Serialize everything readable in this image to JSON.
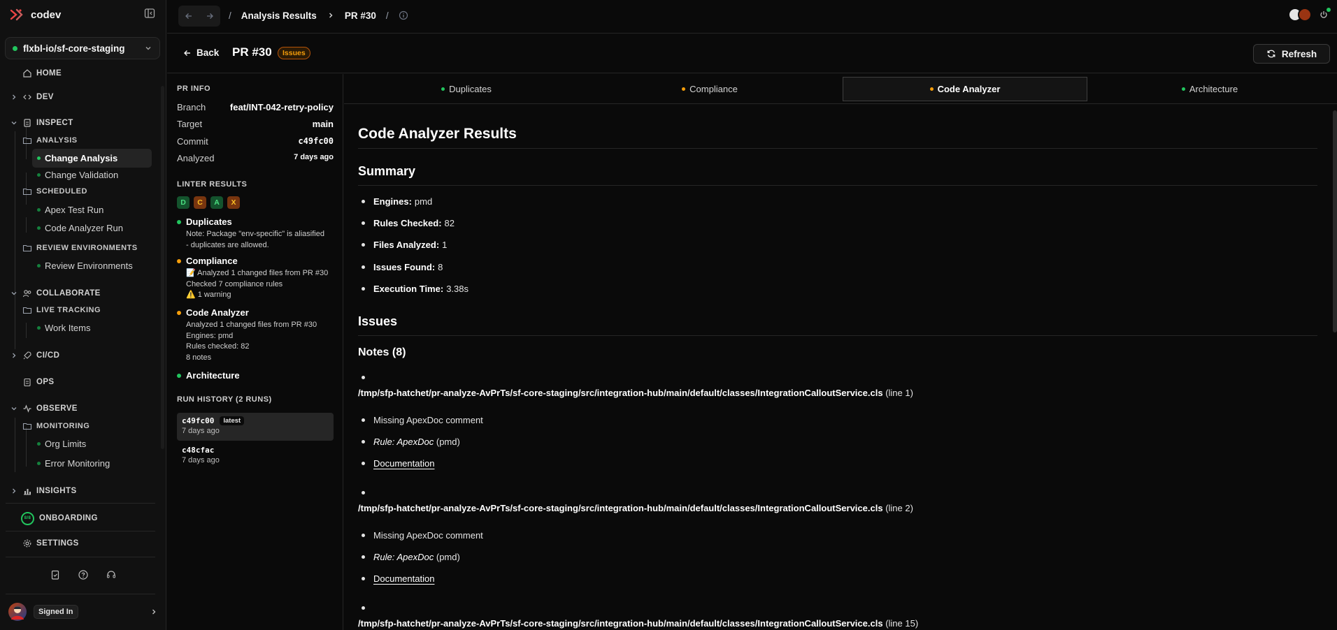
{
  "app": {
    "name": "codev"
  },
  "repo": {
    "name": "flxbl-io/sf-core-staging"
  },
  "nav": {
    "home": "HOME",
    "dev": "DEV",
    "inspect": "INSPECT",
    "analysis": "ANALYSIS",
    "change_analysis": "Change Analysis",
    "change_validation": "Change Validation",
    "scheduled": "SCHEDULED",
    "apex_test_run": "Apex Test Run",
    "code_analyzer_run": "Code Analyzer Run",
    "review_envs_group": "REVIEW ENVIRONMENTS",
    "review_envs": "Review Environments",
    "collaborate": "COLLABORATE",
    "live_tracking": "LIVE TRACKING",
    "work_items": "Work Items",
    "cicd": "CI/CD",
    "ops": "OPS",
    "observe": "OBSERVE",
    "monitoring": "MONITORING",
    "org_limits": "Org Limits",
    "error_monitoring": "Error Monitoring",
    "insights": "INSIGHTS",
    "onboarding": "ONBOARDING",
    "onboarding_progress": "8/8",
    "settings": "SETTINGS"
  },
  "user": {
    "status": "Signed In"
  },
  "breadcrumb": {
    "first": "Analysis Results",
    "second": "PR #30"
  },
  "header": {
    "back": "Back",
    "title": "PR #30",
    "badge": "Issues",
    "refresh": "Refresh"
  },
  "pr_info": {
    "heading": "PR INFO",
    "branch_label": "Branch",
    "branch": "feat/INT-042-retry-policy",
    "target_label": "Target",
    "target": "main",
    "commit_label": "Commit",
    "commit": "c49fc00",
    "analyzed_label": "Analyzed",
    "analyzed": "7 days ago"
  },
  "linter": {
    "heading": "LINTER RESULTS",
    "chips": [
      "D",
      "C",
      "A",
      "X"
    ],
    "items": [
      {
        "title": "Duplicates",
        "status": "ok",
        "lines": [
          "Note: Package \"env-specific\" is aliasified",
          "- duplicates are allowed."
        ]
      },
      {
        "title": "Compliance",
        "status": "warn",
        "lines": [
          "📝 Analyzed 1 changed files from PR #30",
          "Checked 7 compliance rules",
          "⚠️ 1 warning"
        ]
      },
      {
        "title": "Code Analyzer",
        "status": "warn",
        "lines": [
          "Analyzed 1 changed files from PR #30",
          "Engines: pmd",
          "Rules checked: 82",
          "8 notes"
        ]
      },
      {
        "title": "Architecture",
        "status": "ok",
        "lines": []
      }
    ]
  },
  "runs": {
    "heading": "RUN HISTORY (2 RUNS)",
    "items": [
      {
        "sha": "c49fc00",
        "tag": "latest",
        "ago": "7 days ago"
      },
      {
        "sha": "c48cfac",
        "tag": "",
        "ago": "7 days ago"
      }
    ]
  },
  "tabs": [
    "Duplicates",
    "Compliance",
    "Code Analyzer",
    "Architecture"
  ],
  "content": {
    "title": "Code Analyzer Results",
    "summary_heading": "Summary",
    "summary": [
      {
        "label": "Engines:",
        "value": "pmd"
      },
      {
        "label": "Rules Checked:",
        "value": "82"
      },
      {
        "label": "Files Analyzed:",
        "value": "1"
      },
      {
        "label": "Issues Found:",
        "value": "8"
      },
      {
        "label": "Execution Time:",
        "value": "3.38s"
      }
    ],
    "issues_heading": "Issues",
    "notes_heading": "Notes (8)",
    "notes": [
      {
        "path": "/tmp/sfp-hatchet/pr-analyze-AvPrTs/sf-core-staging/src/integration-hub/main/default/classes/IntegrationCalloutService.cls",
        "line": "(line 1)",
        "message": "Missing ApexDoc comment",
        "rule_label": "Rule: ApexDoc",
        "engine": "(pmd)",
        "link": "Documentation"
      },
      {
        "path": "/tmp/sfp-hatchet/pr-analyze-AvPrTs/sf-core-staging/src/integration-hub/main/default/classes/IntegrationCalloutService.cls",
        "line": "(line 2)",
        "message": "Missing ApexDoc comment",
        "rule_label": "Rule: ApexDoc",
        "engine": "(pmd)",
        "link": "Documentation"
      },
      {
        "path": "/tmp/sfp-hatchet/pr-analyze-AvPrTs/sf-core-staging/src/integration-hub/main/default/classes/IntegrationCalloutService.cls",
        "line": "(line 15)",
        "message": "",
        "rule_label": "",
        "engine": "",
        "link": ""
      }
    ]
  },
  "colors": {
    "ok": "#22c55e",
    "warn": "#f59e0b",
    "accent_red": "#ef4444"
  }
}
